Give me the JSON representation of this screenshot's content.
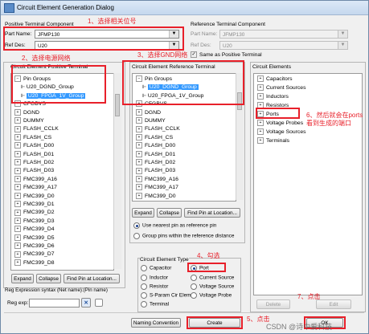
{
  "window": {
    "title": "Circuit Element Generation Dialog"
  },
  "positive": {
    "header": "Positive Terminal Component",
    "part_name_label": "Part Name:",
    "part_name_value": "JFMP130",
    "ref_des_label": "Ref Des:",
    "ref_des_value": "U20"
  },
  "reference": {
    "header": "Reference Terminal Component",
    "part_name_label": "Part Name:",
    "part_name_value": "JFMP130",
    "ref_des_label": "Ref Des:",
    "ref_des_value": "U20",
    "same_as_positive": "Same as Positive Terminal"
  },
  "annotations": {
    "a1": "1、选择相关位号",
    "a2": "2、选择电源网络",
    "a3": "3、选择GND网络",
    "a4": "4、勾选",
    "a5": "5、点击",
    "a6": "6、然后就会在ports看到生成的端口",
    "a7": "7、点击"
  },
  "pos_terminal": {
    "header": "Circuit Element Positive Terminal",
    "items": [
      "Pin Groups",
      "U20_DGND_Group",
      "U20_FPGA_1V_Group",
      "CFGBVS",
      "DGND",
      "DUMMY",
      "FLASH_CCLK",
      "FLASH_CS",
      "FLASH_D00",
      "FLASH_D01",
      "FLASH_D02",
      "FLASH_D03",
      "FMC399_A16",
      "FMC399_A17",
      "FMC399_D0",
      "FMC399_D1",
      "FMC399_D2",
      "FMC399_D3",
      "FMC399_D4",
      "FMC399_D5",
      "FMC399_D6",
      "FMC399_D7",
      "FMC399_D8"
    ],
    "expand": "Expand",
    "collapse": "Collapse",
    "find_pin": "Find Pin at Location...",
    "regexp_syntax": "Reg Expression syntax (Net name):(Pin name)",
    "regexp_label": "Reg exp:"
  },
  "ref_terminal": {
    "header": "Circuit Element Reference Terminal",
    "items": [
      "Pin Groups",
      "U20_DGND_Group",
      "U20_FPGA_1V_Group",
      "CFGBVS",
      "DGND",
      "DUMMY",
      "FLASH_CCLK",
      "FLASH_CS",
      "FLASH_D00",
      "FLASH_D01",
      "FLASH_D02",
      "FLASH_D03",
      "FMC399_A16",
      "FMC399_A17",
      "FMC399_D0"
    ],
    "expand": "Expand",
    "collapse": "Collapse",
    "find_pin": "Find Pin at Location...",
    "opt1": "Use nearest pin as reference pin",
    "opt2": "Group pins within the reference distance"
  },
  "elem_type": {
    "header": "Circuit Element Type",
    "capacitor": "Capacitor",
    "port": "Port",
    "inductor": "Inductor",
    "current_source": "Current Source",
    "resistor": "Resistor",
    "voltage_source": "Voltage Source",
    "s_param": "S-Param Cir Elem",
    "voltage_probe": "Voltage Probe",
    "terminal": "Terminal"
  },
  "circuit_elements": {
    "header": "Circuit Elements",
    "items": [
      "Capacitors",
      "Current Sources",
      "Inductors",
      "Resistors",
      "Ports",
      "Voltage Probes",
      "Voltage Sources",
      "Terminals"
    ],
    "delete": "Delete",
    "edit": "Edit"
  },
  "footer": {
    "naming": "Naming Convention",
    "create": "Create",
    "ok": "OK"
  },
  "watermark": "CSDN @诗中爱科技"
}
